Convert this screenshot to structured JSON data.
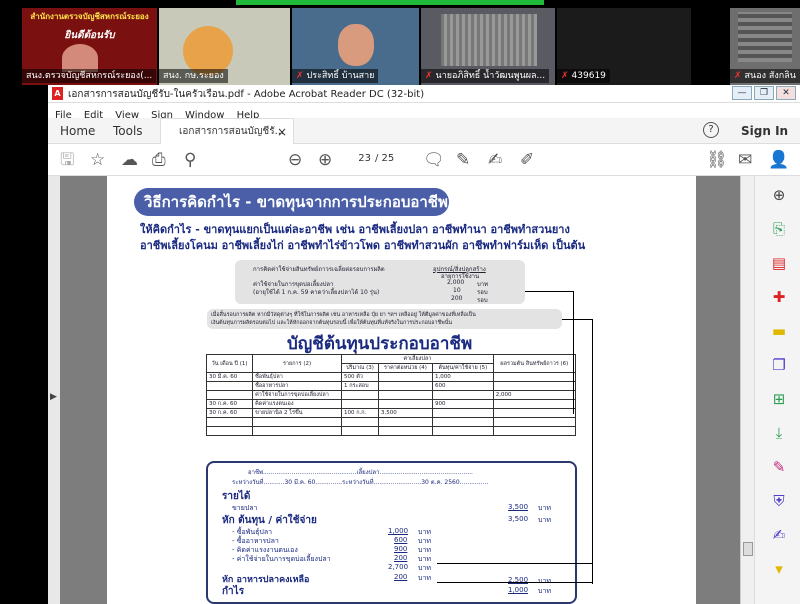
{
  "zoom": {
    "participants": [
      {
        "name": "สนง.ตรวจบัญชีสหกรณ์ระยอง(...",
        "muted": false
      },
      {
        "name": "สนง. กษ.ระยอง",
        "muted": false
      },
      {
        "name": "ประสิทธิ์ บ้านสาย",
        "muted": true
      },
      {
        "name": "นายอภิสิทธิ์ น้ำวัฒนพูนผล...",
        "muted": true
      },
      {
        "name": "439619",
        "muted": true
      },
      {
        "name": "สนอง สังกลิน",
        "muted": true
      }
    ],
    "banner_lines": [
      "สำนักงานตรวจบัญชีสหกรณ์ระยอง",
      "ยินดีต้อนรับ"
    ]
  },
  "window": {
    "title": "เอกสารการสอนบัญชีรับ-ในครัวเรือน.pdf - Adobe Acrobat Reader DC (32-bit)",
    "controls": [
      "—",
      "❐",
      "✕"
    ],
    "menu": [
      "File",
      "Edit",
      "View",
      "Sign",
      "Window",
      "Help"
    ]
  },
  "tabs": {
    "home": "Home",
    "tools": "Tools",
    "doc": "เอกสารการสอนบัญชีรั...",
    "close": "×",
    "help": "?",
    "signin": "Sign In"
  },
  "toolbar": {
    "page_current": "23",
    "page_total": "/ 25"
  },
  "page": {
    "heading": "วิธีการคิดกำไร - ขาดทุนจากการประกอบอาชีพ",
    "intro1": "ให้คิดกำไร - ขาดทุนแยกเป็นแต่ละอาชีพ เช่น อาชีพเลี้ยงปลา อาชีพทำนา อาชีพทำสวนยาง",
    "intro2": "อาชีพเลี้ยงโคนม อาชีพเลี้ยงไก่ อาชีพทำไร่ข้าวโพด อาชีพทำสวนผัก อาชีพทำฟาร์มเห็ด เป็นต้น",
    "calc": {
      "l1": "การคิดค่าใช้จ่ายสินทรัพย์ถาวรเฉลี่ยต่อรอบการผลิต",
      "r1": "อุปกรณ์/สิ่งปลูกสร้าง",
      "r1b": "อายุการใช้งาน",
      "l2": "ค่าใช้จ่ายในการขุดบ่อเลี้ยงปลา",
      "v2": "2,000",
      "u2": "บาท",
      "l3": "(อายุใช้ได้ 1 ก.ค. 59 คาดว่าเลี้ยงปลาได้ 10 รุ่น)",
      "v3": "10",
      "u3": "รอบ",
      "v4": "200",
      "u4": "รอบ"
    },
    "note1": "เมื่อสิ้นรอบการผลิต หากมีวัสดุต่างๆ ที่ใช้ในการผลิต เช่น อาหารเหลือ ปุ๋ย ยา ฯลฯ เหลืออยู่ ให้ตีมูลค่าของที่เหลือเป็น",
    "note2": "เงินต้นทุนการผลิตรอบต่อไป และให้หักออกจากต้นทุนรอบนี้ เพื่อให้ต้นทุนที่แท้จริงในการประกอบอาชีพนั้น",
    "ledger_title": "บัญชีต้นทุนประกอบอาชีพ",
    "ledger": {
      "headers": [
        "วัน เดือน ปี (1)",
        "รายการ (2)",
        "ปริมาณ (3)",
        "ราคาต่อหน่วย (4)",
        "ต้นทุน/ค่าใช้จ่าย (5)",
        "ผลรวมต้น สินทรัพย์ถาวร (6)"
      ],
      "group": "ค่าเลี้ยงปลา",
      "group_left": "ค่าแรง",
      "rows": [
        [
          "30 มี.ค. 60",
          "ซื้อพันธุ์ปลา",
          "500 ตัว",
          "",
          "1,000",
          ""
        ],
        [
          "",
          "ซื้ออาหารปลา",
          "1 กระสอบ",
          "",
          "600",
          ""
        ],
        [
          "",
          "ค่าใช้จ่ายในการขุดบ่อเลี้ยงปลา",
          "",
          "",
          "",
          "2,000"
        ],
        [
          "30 ก.ค. 60",
          "คิดค่าแรงตนเอง",
          "",
          "",
          "900",
          ""
        ],
        [
          "30 ก.ค. 60",
          "ขายปลานิล 2 ไร่ขึ้น",
          "100 ก.ก.",
          "3,500",
          "",
          ""
        ]
      ]
    },
    "pl": {
      "career": "อาชีพ.................................................เลี้ยงปลา.................................................",
      "period": "ระหว่างวันที่...........30 มี.ค. 60..............ระหว่างวันที่.........................30 ต.ค. 2560...............",
      "income": "รายได้",
      "sale": "ขายปลา",
      "sale_v": "3,500",
      "u": "บาท",
      "deduct": "หัก ต้นทุน / ค่าใช้จ่าย",
      "deduct_v": "3,500",
      "items": [
        [
          "- ซื้อพันธุ์ปลา",
          "1,000"
        ],
        [
          "- ซื้ออาหารปลา",
          "600"
        ],
        [
          "- คิดค่าแรงงานตนเอง",
          "900"
        ],
        [
          "- ค่าใช้จ่ายในการขุดบ่อเลี้ยงปลา",
          "200"
        ]
      ],
      "sum_v": "2,700",
      "food_left": "หัก อาหารปลาคงเหลือ",
      "food_left_v": "200",
      "cost_total": "2,500",
      "profit": "กำไร",
      "profit_v": "1,000"
    }
  },
  "colors": {
    "accent": "#4a5fa8",
    "text_blue": "#1a2a80",
    "zoom_green": "#1fba3a"
  }
}
